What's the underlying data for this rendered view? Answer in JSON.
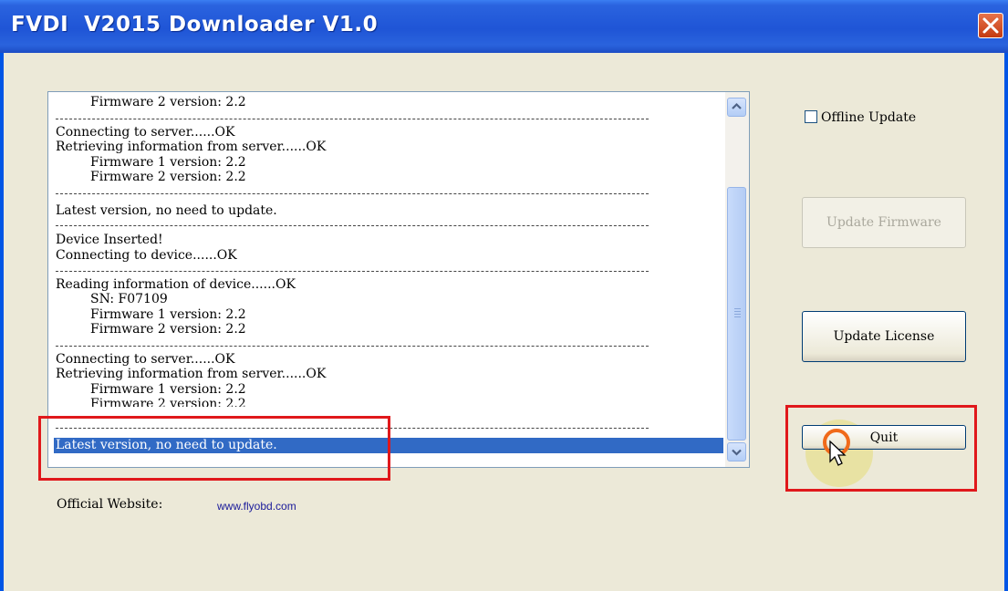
{
  "window": {
    "title": "FVDI  V2015 Downloader V1.0"
  },
  "log": {
    "lines": [
      "Firmware 2 version: 2.2",
      "Connecting to server......OK",
      "Retrieving information from server......OK",
      "Firmware 1 version: 2.2",
      "Firmware 2 version: 2.2",
      "Latest version, no need to update.",
      "Device Inserted!",
      "Connecting to device......OK",
      "Reading information of device......OK",
      "SN: F07109",
      "Firmware 1 version: 2.2",
      "Firmware 2 version: 2.2",
      "Connecting to server......OK",
      "Retrieving information from server......OK",
      "Firmware 1 version: 2.2",
      "Firmware 2 version: 2.2"
    ],
    "selected_line": "Latest version, no need to update."
  },
  "controls": {
    "offline_update_label": "Offline Update",
    "offline_update_checked": false,
    "update_firmware_label": "Update Firmware",
    "update_firmware_enabled": false,
    "update_license_label": "Update License",
    "quit_label": "Quit"
  },
  "footer": {
    "website_label": "Official Website:",
    "website_url": "www.flyobd.com"
  },
  "colors": {
    "titlebar": "#2a63df",
    "selection": "#316ac5",
    "highlight_box": "#e0181b"
  }
}
